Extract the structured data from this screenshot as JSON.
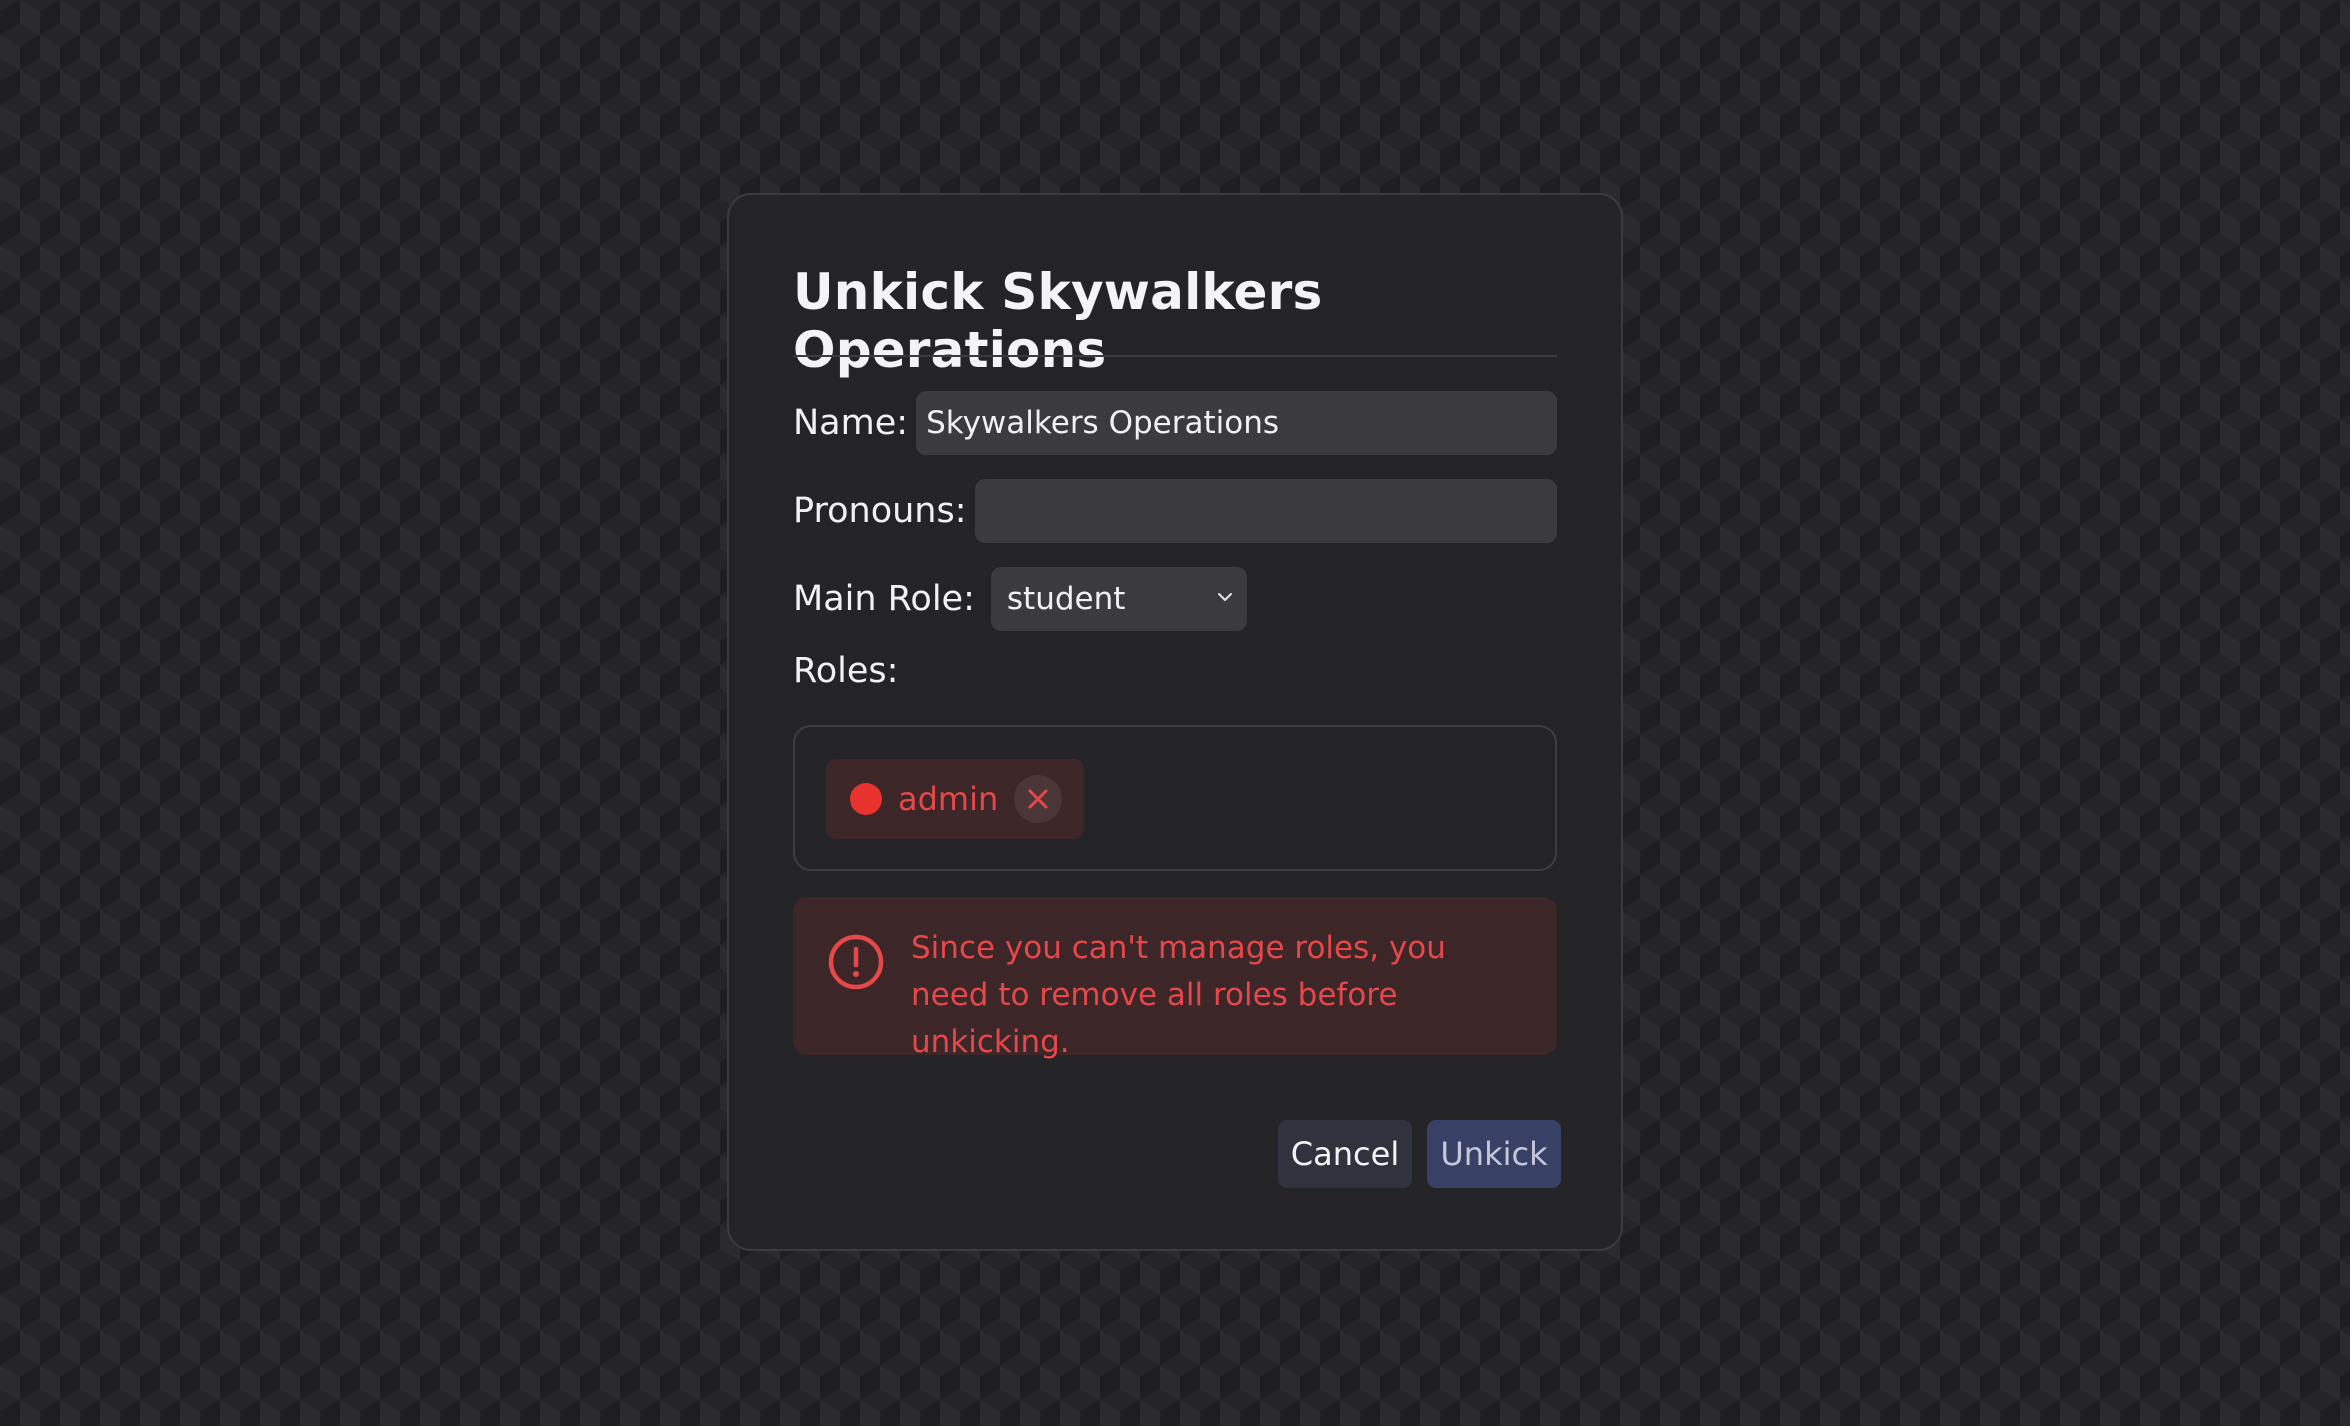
{
  "modal": {
    "title": "Unkick Skywalkers Operations",
    "name_label": "Name:",
    "name_value": "Skywalkers Operations",
    "pronouns_label": "Pronouns:",
    "pronouns_value": "",
    "main_role_label": "Main Role:",
    "main_role_selected": "student",
    "roles_label": "Roles:",
    "roles": [
      {
        "name": "admin",
        "color": "#e8322e",
        "remove_icon": "close-icon"
      }
    ],
    "alert": {
      "icon": "exclamation-circle-icon",
      "text": "Since you can't manage roles, you need to remove all roles before unkicking."
    },
    "cancel_label": "Cancel",
    "unkick_label": "Unkick"
  },
  "colors": {
    "danger": "#e5474a",
    "primary_disabled": "#384066"
  }
}
